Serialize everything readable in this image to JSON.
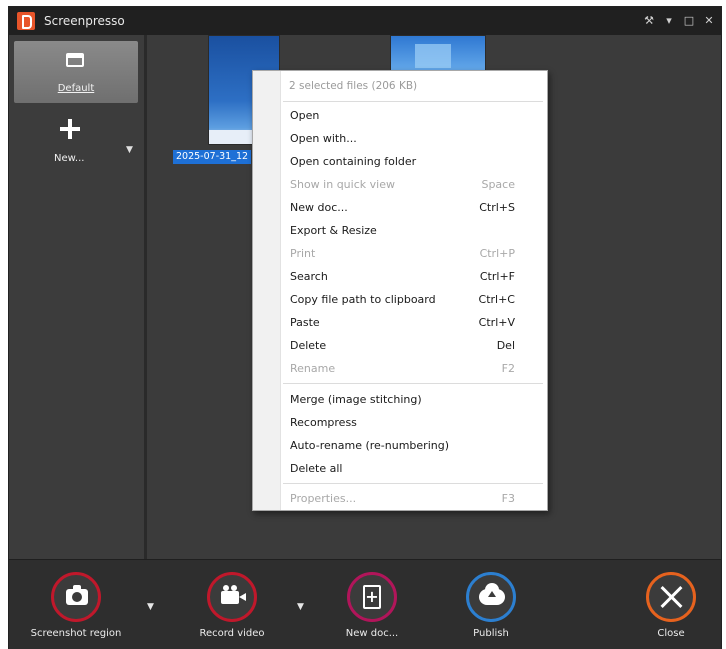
{
  "window": {
    "title": "Screenpresso"
  },
  "title_controls": {
    "tools_icon": "wrench-icon",
    "menu_icon": "chevron-down-icon",
    "restore_icon": "restore-icon",
    "close_icon": "close-icon"
  },
  "sidebar": {
    "default_label": "Default",
    "new_label": "New...",
    "dropdown_glyph": "▼"
  },
  "content": {
    "thumbnail_1_label": "2025-07-31_12"
  },
  "context_menu": {
    "header": "2 selected files (206 KB)",
    "items": [
      {
        "label": "Open",
        "shortcut": "",
        "enabled": true
      },
      {
        "label": "Open with...",
        "shortcut": "",
        "enabled": true
      },
      {
        "label": "Open containing folder",
        "shortcut": "",
        "enabled": true
      },
      {
        "label": "Show in quick view",
        "shortcut": "Space",
        "enabled": false
      },
      {
        "label": "New doc...",
        "shortcut": "Ctrl+S",
        "enabled": true
      },
      {
        "label": "Export & Resize",
        "shortcut": "",
        "enabled": true
      },
      {
        "label": "Print",
        "shortcut": "Ctrl+P",
        "enabled": false
      },
      {
        "label": "Search",
        "shortcut": "Ctrl+F",
        "enabled": true
      },
      {
        "label": "Copy file path to clipboard",
        "shortcut": "Ctrl+C",
        "enabled": true
      },
      {
        "label": "Paste",
        "shortcut": "Ctrl+V",
        "enabled": true
      },
      {
        "label": "Delete",
        "shortcut": "Del",
        "enabled": true
      },
      {
        "label": "Rename",
        "shortcut": "F2",
        "enabled": false
      },
      {
        "label": "Merge (image stitching)",
        "shortcut": "",
        "enabled": true
      },
      {
        "label": "Recompress",
        "shortcut": "",
        "enabled": true
      },
      {
        "label": "Auto-rename (re-numbering)",
        "shortcut": "",
        "enabled": true
      },
      {
        "label": "Delete all",
        "shortcut": "",
        "enabled": true
      },
      {
        "label": "Properties...",
        "shortcut": "F3",
        "enabled": false
      }
    ]
  },
  "toolbar": {
    "screenshot_label": "Screenshot region",
    "record_label": "Record video",
    "newdoc_label": "New doc...",
    "publish_label": "Publish",
    "close_label": "Close",
    "dropdown_glyph": "▼"
  },
  "colors": {
    "screenshot_ring": "#c0182b",
    "record_ring": "#c0182b",
    "newdoc_ring": "#b1155a",
    "publish_ring": "#2c7fd0",
    "close_ring": "#e6621e",
    "selection": "#1e70d6",
    "brand": "#e8552a"
  }
}
